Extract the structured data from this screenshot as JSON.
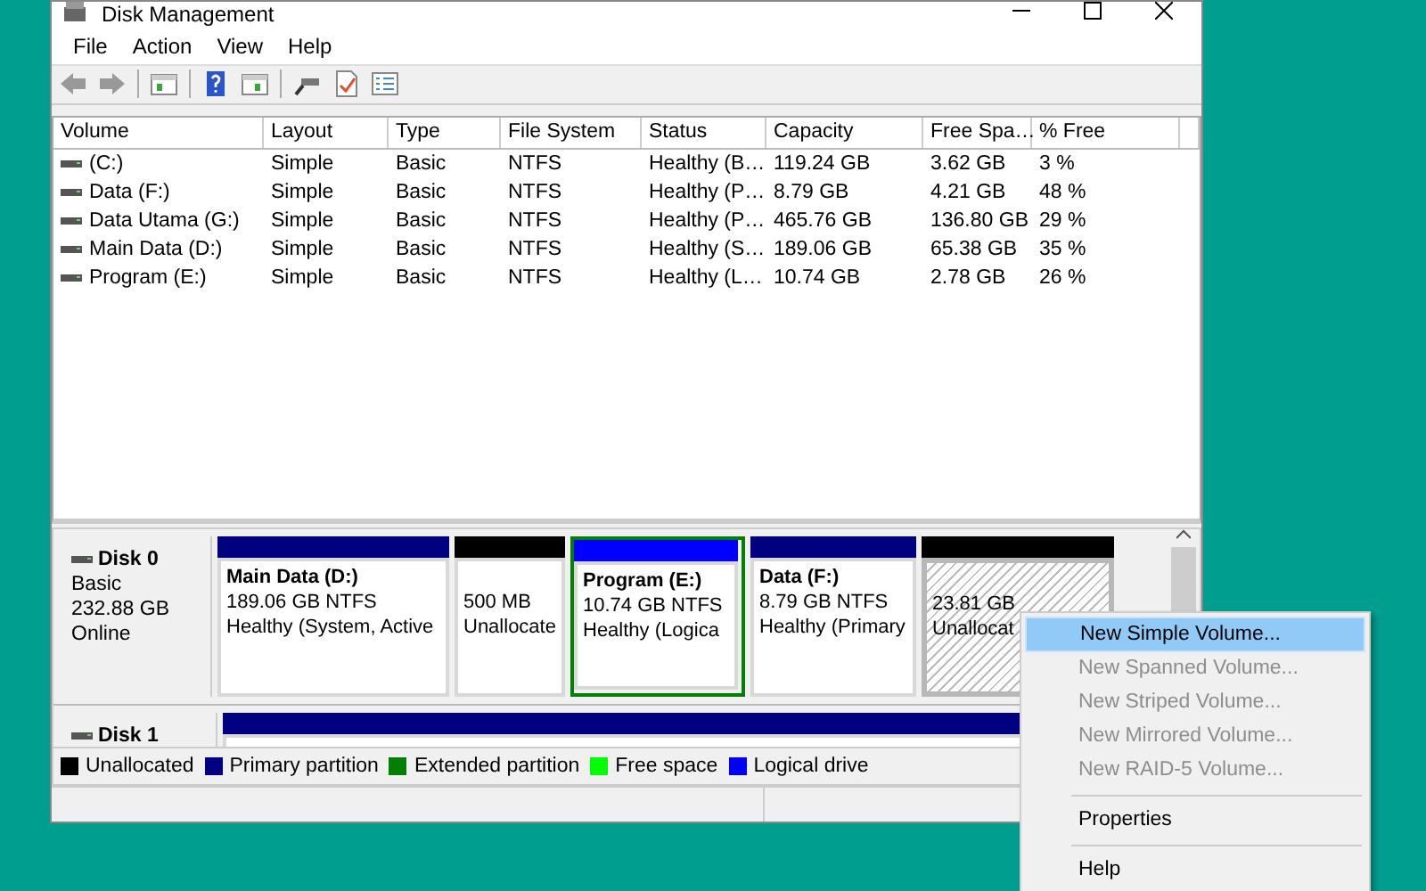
{
  "window": {
    "title": "Disk Management"
  },
  "menu_bar": [
    "File",
    "Action",
    "View",
    "Help"
  ],
  "volume_table": {
    "columns": [
      "Volume",
      "Layout",
      "Type",
      "File System",
      "Status",
      "Capacity",
      "Free Spa…",
      "% Free"
    ],
    "rows": [
      [
        "(C:)",
        "Simple",
        "Basic",
        "NTFS",
        "Healthy (B…",
        "119.24 GB",
        "3.62 GB",
        "3 %"
      ],
      [
        "Data (F:)",
        "Simple",
        "Basic",
        "NTFS",
        "Healthy (P…",
        "8.79 GB",
        "4.21 GB",
        "48 %"
      ],
      [
        "Data Utama (G:)",
        "Simple",
        "Basic",
        "NTFS",
        "Healthy (P…",
        "465.76 GB",
        "136.80 GB",
        "29 %"
      ],
      [
        "Main Data (D:)",
        "Simple",
        "Basic",
        "NTFS",
        "Healthy (S…",
        "189.06 GB",
        "65.38 GB",
        "35 %"
      ],
      [
        "Program (E:)",
        "Simple",
        "Basic",
        "NTFS",
        "Healthy (L…",
        "10.74 GB",
        "2.78 GB",
        "26 %"
      ]
    ]
  },
  "disks": [
    {
      "name": "Disk 0",
      "type": "Basic",
      "size": "232.88 GB",
      "status": "Online",
      "partitions": [
        {
          "kind": "primary",
          "selected": false,
          "name": "Main Data  (D:)",
          "size": "189.06 GB NTFS",
          "status": "Healthy (System, Active"
        },
        {
          "kind": "unallocated",
          "selected": false,
          "size": "500 MB",
          "status": "Unallocate"
        },
        {
          "kind": "logical",
          "selected": false,
          "name": "Program  (E:)",
          "size": "10.74 GB NTFS",
          "status": "Healthy (Logica"
        },
        {
          "kind": "primary",
          "selected": false,
          "name": "Data  (F:)",
          "size": "8.79 GB NTFS",
          "status": "Healthy (Primary"
        },
        {
          "kind": "unallocated",
          "selected": true,
          "size": "23.81 GB",
          "status": "Unallocat"
        }
      ]
    },
    {
      "name": "Disk 1",
      "partitions": [
        {
          "kind": "primary",
          "selected": false
        }
      ]
    }
  ],
  "legend": [
    {
      "label": "Unallocated",
      "color": "#000000"
    },
    {
      "label": "Primary partition",
      "color": "#000080"
    },
    {
      "label": "Extended partition",
      "color": "#008000"
    },
    {
      "label": "Free space",
      "color": "#00ff00"
    },
    {
      "label": "Logical drive",
      "color": "#0000ff"
    }
  ],
  "context_menu": [
    {
      "kind": "item",
      "label": "New Simple Volume...",
      "disabled": false,
      "selected": true
    },
    {
      "kind": "item",
      "label": "New Spanned Volume...",
      "disabled": true,
      "selected": false
    },
    {
      "kind": "item",
      "label": "New Striped Volume...",
      "disabled": true,
      "selected": false
    },
    {
      "kind": "item",
      "label": "New Mirrored Volume...",
      "disabled": true,
      "selected": false
    },
    {
      "kind": "item",
      "label": "New RAID-5 Volume...",
      "disabled": true,
      "selected": false
    },
    {
      "kind": "separator"
    },
    {
      "kind": "item",
      "label": "Properties",
      "disabled": false,
      "selected": false
    },
    {
      "kind": "separator"
    },
    {
      "kind": "item",
      "label": "Help",
      "disabled": false,
      "selected": false
    }
  ]
}
